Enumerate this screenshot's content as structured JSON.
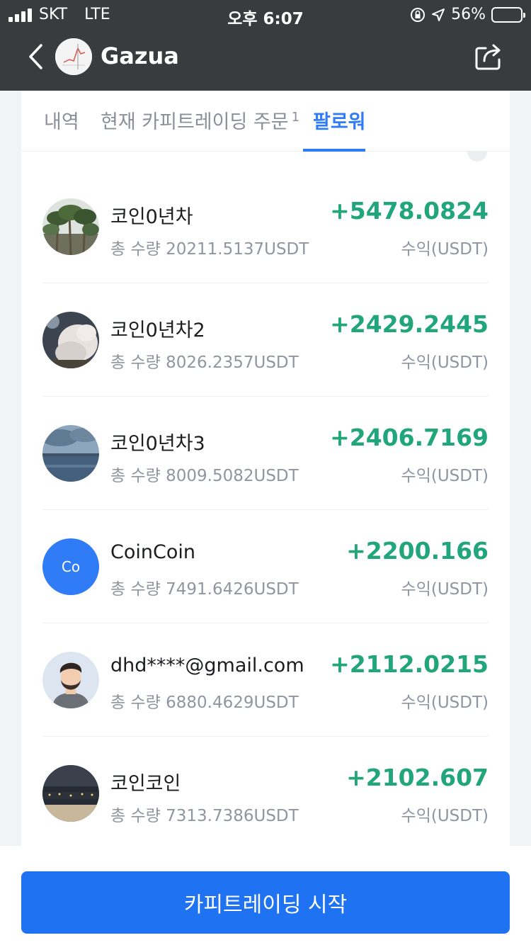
{
  "status_bar": {
    "carrier": "SKT",
    "network": "LTE",
    "time": "오후 6:07",
    "battery_percent": "56%",
    "battery_level": 0.56
  },
  "nav": {
    "title": "Gazua",
    "back_icon": "chevron-left-icon",
    "share_icon": "share-icon"
  },
  "tabs": [
    {
      "label": "내역",
      "badge": ""
    },
    {
      "label": "현재 카피트레이딩 주문",
      "badge": "1"
    },
    {
      "label": "팔로워",
      "badge": ""
    }
  ],
  "active_tab": 2,
  "followers": [
    {
      "name": "코인0년차",
      "total": "총 수량 20211.5137USDT",
      "profit": "+5478.0824",
      "unit": "수익(USDT)",
      "avatar": "photo"
    },
    {
      "name": "코인0년차2",
      "total": "총 수량 8026.2357USDT",
      "profit": "+2429.2445",
      "unit": "수익(USDT)",
      "avatar": "photo"
    },
    {
      "name": "코인0년차3",
      "total": "총 수량 8009.5082USDT",
      "profit": "+2406.7169",
      "unit": "수익(USDT)",
      "avatar": "photo"
    },
    {
      "name": "CoinCoin",
      "total": "총 수량 7491.6426USDT",
      "profit": "+2200.166",
      "unit": "수익(USDT)",
      "avatar": "Co"
    },
    {
      "name": "dhd****@gmail.com",
      "total": "총 수량 6880.4629USDT",
      "profit": "+2112.0215",
      "unit": "수익(USDT)",
      "avatar": "person"
    },
    {
      "name": "코인코인",
      "total": "총 수량 7313.7386USDT",
      "profit": "+2102.607",
      "unit": "수익(USDT)",
      "avatar": "photo"
    }
  ],
  "cta": {
    "label": "카피트레이딩 시작"
  },
  "colors": {
    "header_bg": "#3a3b3d",
    "accent": "#2f7cf6",
    "profit": "#20a67a",
    "cta_bg": "#1f72f2"
  }
}
